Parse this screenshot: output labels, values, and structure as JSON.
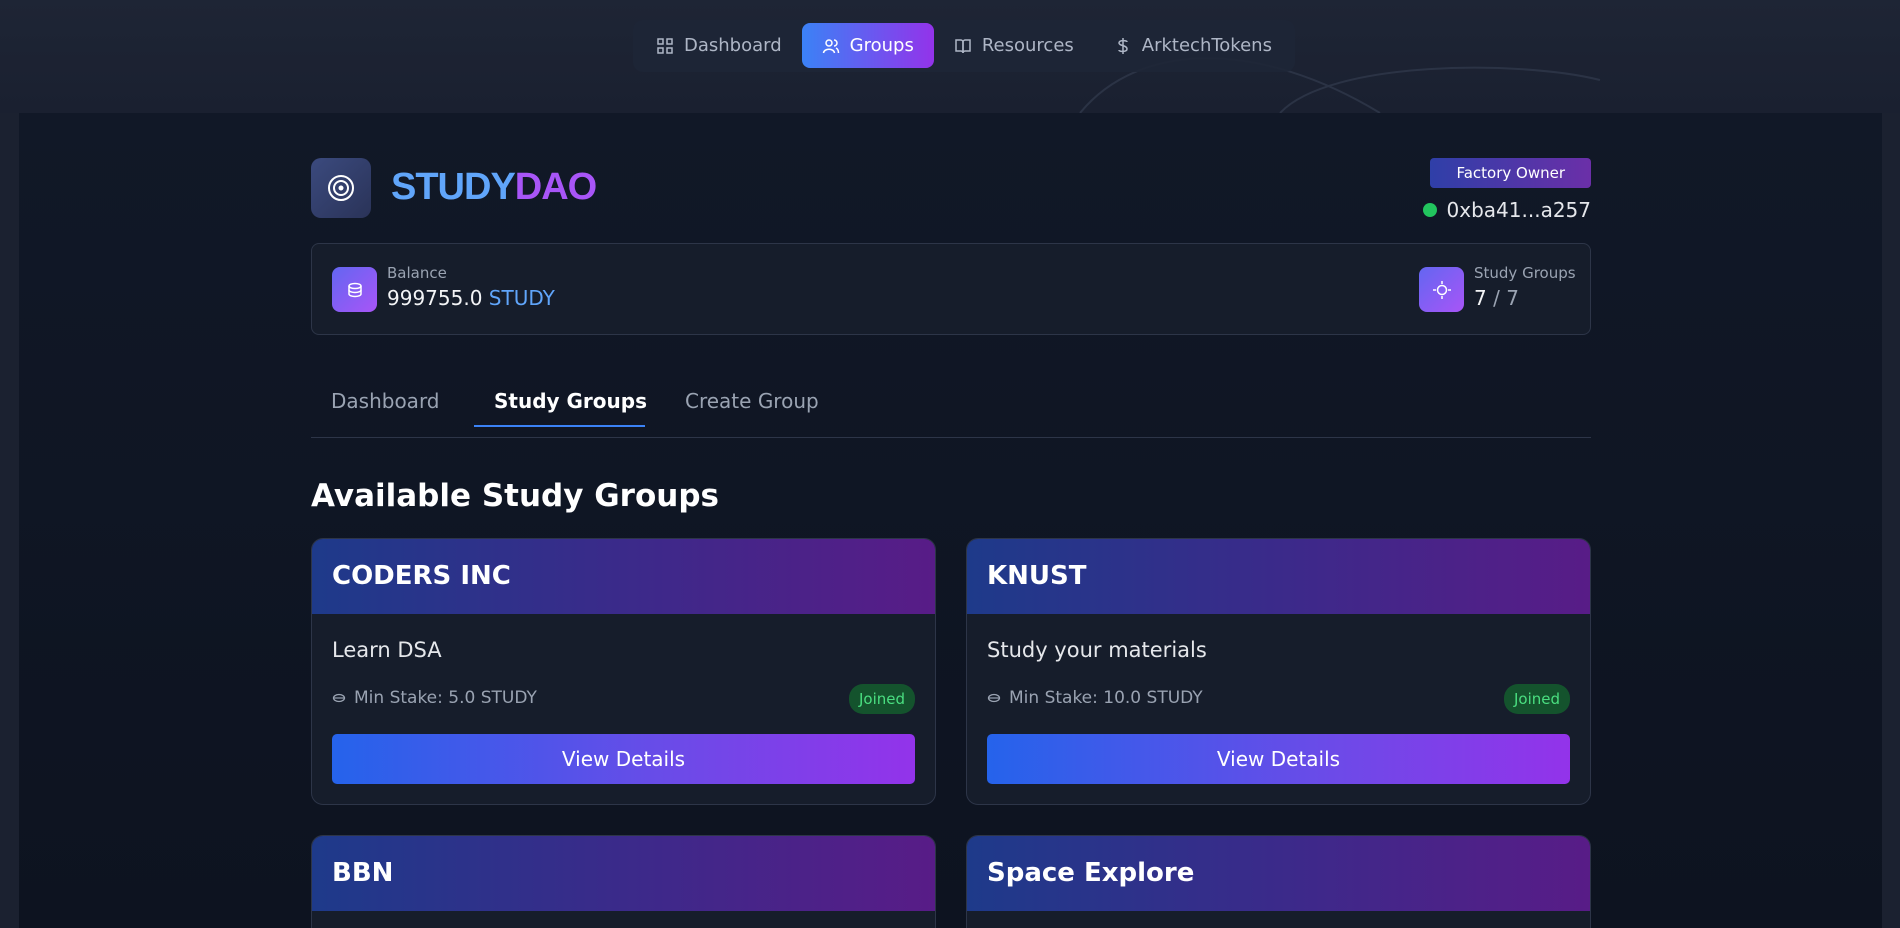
{
  "nav": {
    "items": [
      {
        "label": "Dashboard",
        "icon": "grid-icon"
      },
      {
        "label": "Groups",
        "icon": "users-icon"
      },
      {
        "label": "Resources",
        "icon": "book-icon"
      },
      {
        "label": "ArktechTokens",
        "icon": "dollar-icon"
      }
    ],
    "active": "Groups"
  },
  "brand": {
    "part1": "STUDY",
    "part2": "DAO"
  },
  "account": {
    "role": "Factory Owner",
    "address": "0xba41...a257"
  },
  "stats": {
    "balance": {
      "label": "Balance",
      "amount": "999755.0",
      "unit": "STUDY"
    },
    "groups": {
      "label": "Study Groups",
      "current": "7",
      "separator": "/ 7"
    }
  },
  "tabs": [
    {
      "label": "Dashboard"
    },
    {
      "label": "Study Groups"
    },
    {
      "label": "Create Group"
    }
  ],
  "section_title": "Available Study Groups",
  "groups": [
    {
      "name": "CODERS INC",
      "description": "Learn DSA",
      "stake": "Min Stake: 5.0 STUDY",
      "status": "Joined",
      "button": "View Details"
    },
    {
      "name": "KNUST",
      "description": "Study your materials",
      "stake": "Min Stake: 10.0 STUDY",
      "status": "Joined",
      "button": "View Details"
    },
    {
      "name": "BBN"
    },
    {
      "name": "Space Explore"
    }
  ],
  "colors": {
    "accent_blue": "#3b82f6",
    "accent_purple": "#9333ea",
    "joined_green": "#4ade80",
    "online_dot": "#22c55e"
  }
}
